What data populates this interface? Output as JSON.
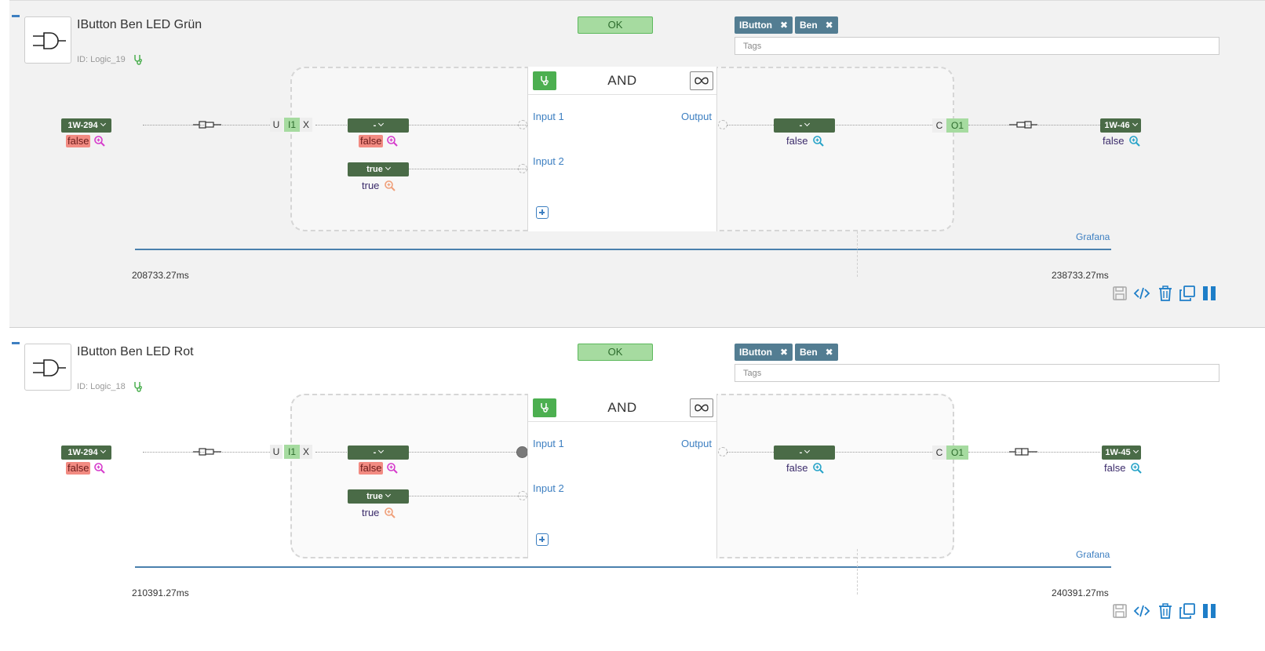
{
  "logics": [
    {
      "title": "IButton Ben LED Grün",
      "id_text": "ID: Logic_19",
      "status": "OK",
      "tags": [
        "IButton",
        "Ben"
      ],
      "tags_placeholder": "Tags",
      "function": "AND",
      "input_labels": [
        "Input 1",
        "Input 2"
      ],
      "output_label": "Output",
      "source": {
        "label": "1W-294",
        "value": "false"
      },
      "input_slots": {
        "u": "U",
        "i1": "I1",
        "x": "X"
      },
      "input1_dropdown": {
        "label": "-",
        "value": "false"
      },
      "input2_dropdown": {
        "label": "true",
        "value": "true"
      },
      "output_dropdown": {
        "label": "-",
        "value": "false"
      },
      "output_slots": {
        "c": "C",
        "o1": "O1"
      },
      "target": {
        "label": "1W-46",
        "value": "false"
      },
      "grafana": "Grafana",
      "time_start": "208733.27ms",
      "time_end": "238733.27ms",
      "input1_connected": false
    },
    {
      "title": "IButton Ben LED Rot",
      "id_text": "ID: Logic_18",
      "status": "OK",
      "tags": [
        "IButton",
        "Ben"
      ],
      "tags_placeholder": "Tags",
      "function": "AND",
      "input_labels": [
        "Input 1",
        "Input 2"
      ],
      "output_label": "Output",
      "source": {
        "label": "1W-294",
        "value": "false"
      },
      "input_slots": {
        "u": "U",
        "i1": "I1",
        "x": "X"
      },
      "input1_dropdown": {
        "label": "-",
        "value": "false"
      },
      "input2_dropdown": {
        "label": "true",
        "value": "true"
      },
      "output_dropdown": {
        "label": "-",
        "value": "false"
      },
      "output_slots": {
        "c": "C",
        "o1": "O1"
      },
      "target": {
        "label": "1W-45",
        "value": "false"
      },
      "grafana": "Grafana",
      "time_start": "210391.27ms",
      "time_end": "240391.27ms",
      "input1_connected": true
    }
  ],
  "icons": {
    "collapse": "minus-icon",
    "gate": "and-gate-icon",
    "health": "stethoscope-icon",
    "remove_tag": "close-icon",
    "loop": "infinity-icon",
    "add": "plus-square-icon",
    "inspect": "magnifier-plus-icon",
    "plug": "plug-icon",
    "save": "save-icon",
    "code": "code-icon",
    "delete": "trash-icon",
    "copy": "copy-icon",
    "pause": "pause-icon"
  },
  "colors": {
    "accent_blue": "#3d7fc1",
    "ok_green_bg": "#a6dba0",
    "dropdown_green": "#4a6b47",
    "tag_slate": "#537d92",
    "false_red": "#f28b82",
    "stetho_green": "#4caf50",
    "timeline_blue": "#4a80ad"
  }
}
